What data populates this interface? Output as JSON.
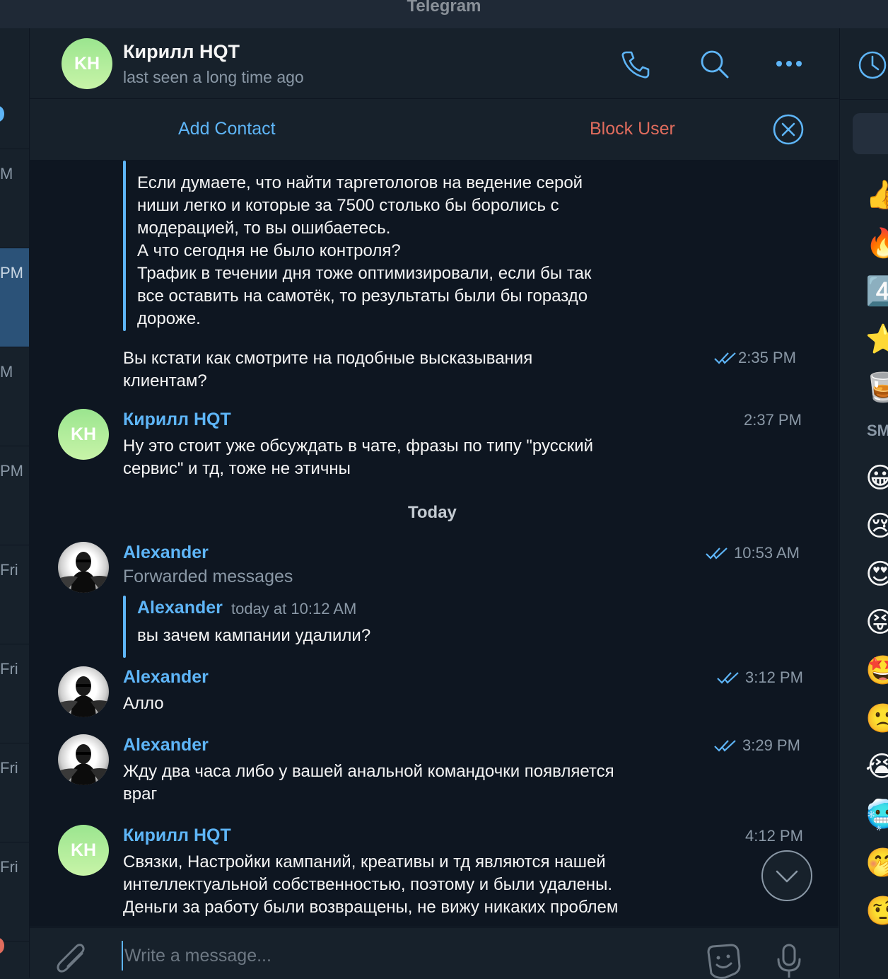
{
  "window": {
    "title": "Telegram"
  },
  "chat_list": {
    "items": [
      {
        "time": ""
      },
      {
        "time": "M"
      },
      {
        "time": "PM"
      },
      {
        "time": "M"
      },
      {
        "time": "PM"
      },
      {
        "time": "Fri"
      },
      {
        "time": "Fri"
      },
      {
        "time": "Fri"
      },
      {
        "time": "Fri"
      }
    ]
  },
  "header": {
    "initials": "KH",
    "name": "Кирилл HQT",
    "status": "last seen a long time ago",
    "icons": [
      "phone-icon",
      "search-icon",
      "more-icon"
    ]
  },
  "action_bar": {
    "add_contact": "Add Contact",
    "block_user": "Block User"
  },
  "messages": [
    {
      "type": "quote-continuation",
      "lines": "Если думаете, что найти таргетологов на ведение серой\nниши легко и которые за 7500 столько бы боролись с\nмодерацией, то вы ошибаетесь.\nА что сегодня не было контроля?\nТрафик в течении дня тоже оптимизировали, если бы так\nвсе оставить на самотёк, то результаты были бы гораздо\nдороже."
    },
    {
      "type": "continuation",
      "text": "Вы кстати как смотрите на подобные высказывания\nклиентам?",
      "time": "2:35 PM",
      "read": true
    },
    {
      "type": "message",
      "sender": "Кирилл HQT",
      "initials": "KH",
      "text": "Ну это стоит уже обсуждать в чате, фразы по типу \"русский\nсервис\" и тд, тоже не этичны",
      "time": "2:37 PM"
    },
    {
      "type": "date",
      "label": "Today"
    },
    {
      "type": "forward",
      "sender": "Alexander",
      "subtitle": "Forwarded messages",
      "fwd_sender": "Alexander",
      "fwd_time": "today at 10:12 AM",
      "fwd_text": "вы зачем кампании удалили?",
      "time": "10:53 AM",
      "read": true
    },
    {
      "type": "message",
      "sender": "Alexander",
      "text": "Алло",
      "time": "3:12 PM",
      "read": true
    },
    {
      "type": "message",
      "sender": "Alexander",
      "text": "Жду два часа либо у вашей анальной командочки появляется\nвраг",
      "time": "3:29 PM",
      "read": true
    },
    {
      "type": "message",
      "sender": "Кирилл HQT",
      "initials": "KH",
      "text": "Связки, Настройки кампаний, креативы и тд являются нашей\nинтеллектуальной собственностью, поэтому и были удалены.\nДеньги за работу были возвращены, не вижу никаких проблем",
      "time": "4:12 PM"
    }
  ],
  "composer": {
    "placeholder": "Write a message...",
    "icons": [
      "paperclip-icon",
      "sticker-icon",
      "microphone-icon"
    ]
  },
  "emoji_panel": {
    "label": "SM",
    "emojis_top": [
      "👍",
      "🔥",
      "4️⃣",
      "⭐",
      "🥃"
    ],
    "emojis": [
      "😀",
      "😢",
      "😍",
      "😝",
      "🤩",
      "🙁",
      "😭",
      "🥶",
      "🤭",
      "🤨"
    ]
  },
  "colors": {
    "accent": "#5eb5f7",
    "danger": "#e06c5d",
    "background": "#0e1621",
    "panel": "#17212b"
  }
}
